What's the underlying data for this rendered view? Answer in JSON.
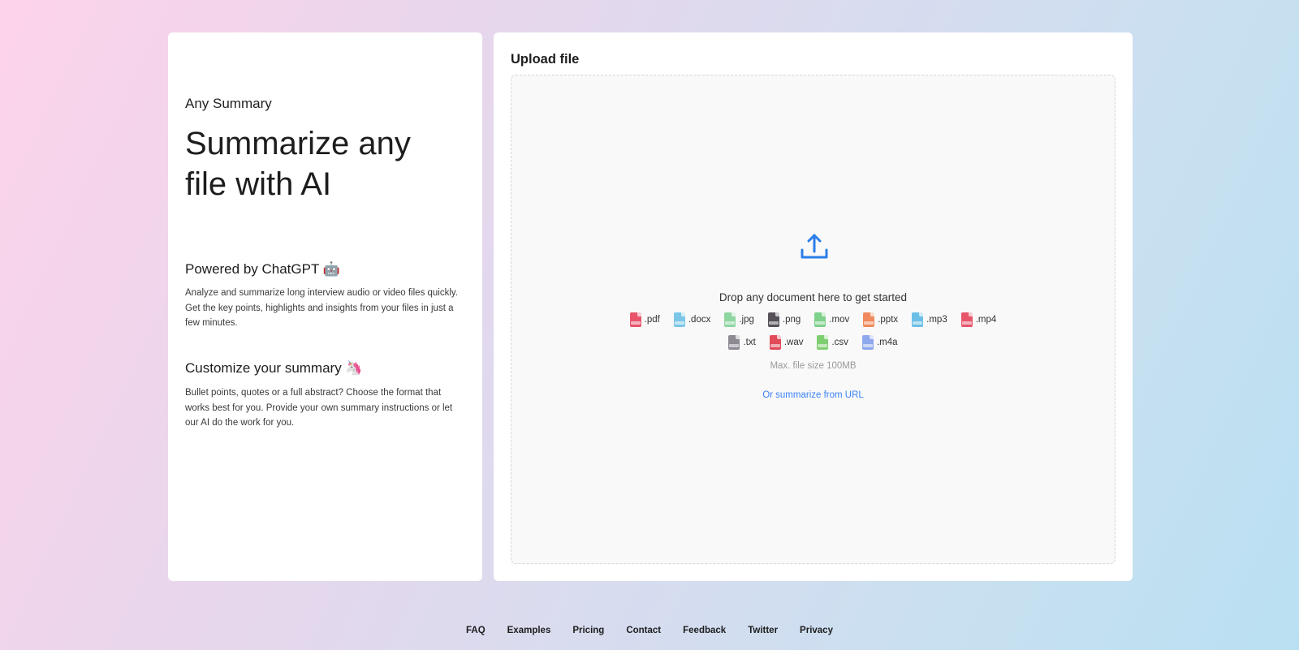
{
  "left": {
    "brand": "Any Summary",
    "headline": "Summarize any file with AI",
    "features": [
      {
        "title": "Powered by ChatGPT 🤖",
        "text": "Analyze and summarize long interview audio or video files quickly. Get the key points, highlights and insights from your files in just a few minutes."
      },
      {
        "title": "Customize your summary 🦄",
        "text": "Bullet points, quotes or a full abstract? Choose the format that works best for you. Provide your own summary instructions or let our AI do the work for you."
      }
    ]
  },
  "upload": {
    "title": "Upload file",
    "drop_text": "Drop any document here to get started",
    "file_types_row1": [
      {
        "ext": ".pdf",
        "icon": "pdf-file-icon",
        "color": "#e8556b"
      },
      {
        "ext": ".docx",
        "icon": "docx-file-icon",
        "color": "#7cc7e8"
      },
      {
        "ext": ".jpg",
        "icon": "jpg-file-icon",
        "color": "#8fd6a1"
      },
      {
        "ext": ".png",
        "icon": "png-file-icon",
        "color": "#55505a"
      },
      {
        "ext": ".mov",
        "icon": "mov-file-icon",
        "color": "#7fd18b"
      },
      {
        "ext": ".pptx",
        "icon": "pptx-file-icon",
        "color": "#f08a5d"
      },
      {
        "ext": ".mp3",
        "icon": "mp3-file-icon",
        "color": "#6bbfe6"
      },
      {
        "ext": ".mp4",
        "icon": "mp4-file-icon",
        "color": "#e8556b"
      }
    ],
    "file_types_row2": [
      {
        "ext": ".txt",
        "icon": "txt-file-icon",
        "color": "#8e8a93"
      },
      {
        "ext": ".wav",
        "icon": "wav-file-icon",
        "color": "#e14b5a"
      },
      {
        "ext": ".csv",
        "icon": "csv-file-icon",
        "color": "#7fcf72"
      },
      {
        "ext": ".m4a",
        "icon": "m4a-file-icon",
        "color": "#8fa8ee"
      }
    ],
    "max_size": "Max. file size 100MB",
    "url_link": "Or summarize from URL",
    "accent_color": "#2b7de9"
  },
  "footer": {
    "links": [
      "FAQ",
      "Examples",
      "Pricing",
      "Contact",
      "Feedback",
      "Twitter",
      "Privacy"
    ]
  }
}
